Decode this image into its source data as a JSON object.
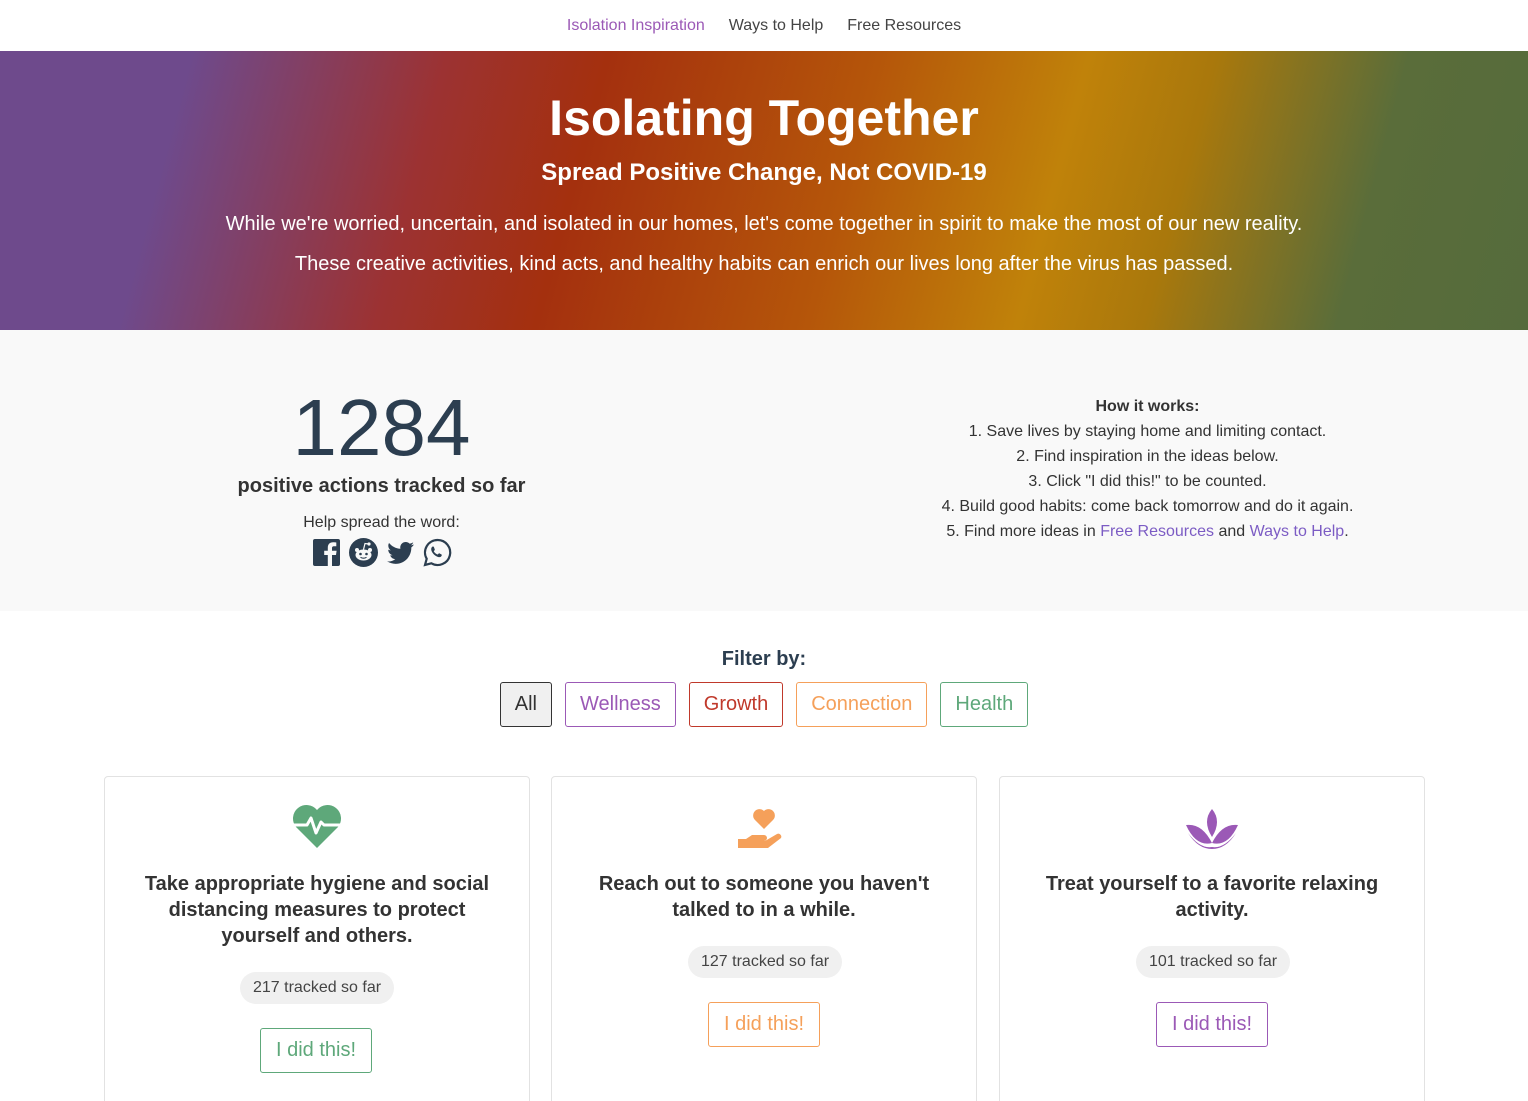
{
  "nav": {
    "items": [
      "Isolation Inspiration",
      "Ways to Help",
      "Free Resources"
    ]
  },
  "hero": {
    "title": "Isolating Together",
    "subtitle": "Spread Positive Change, Not COVID-19",
    "line1": "While we're worried, uncertain, and isolated in our homes, let's come together in spirit to make the most of our new reality.",
    "line2": "These creative activities, kind acts, and healthy habits can enrich our lives long after the virus has passed."
  },
  "stats": {
    "count": "1284",
    "count_label": "positive actions tracked so far",
    "spread_label": "Help spread the word:",
    "social": [
      "facebook-icon",
      "reddit-icon",
      "twitter-icon",
      "whatsapp-icon"
    ]
  },
  "how": {
    "heading": "How it works:",
    "step1": "1. Save lives by staying home and limiting contact.",
    "step2": "2. Find inspiration in the ideas below.",
    "step3": "3. Click \"I did this!\" to be counted.",
    "step4": "4. Build good habits: come back tomorrow and do it again.",
    "step5_prefix": "5. Find more ideas in",
    "step5_link1": "Free Resources",
    "step5_and": "and",
    "step5_link2": "Ways to Help",
    "step5_suffix": "."
  },
  "filter": {
    "label": "Filter by:",
    "buttons": [
      "All",
      "Wellness",
      "Growth",
      "Connection",
      "Health"
    ]
  },
  "cards": [
    {
      "icon": "heartbeat-icon",
      "title": "Take appropriate hygiene and social distancing measures to protect yourself and others.",
      "count": "217 tracked so far",
      "button": "I did this!",
      "color": "#5ea87a"
    },
    {
      "icon": "hand-heart-icon",
      "title": "Reach out to someone you haven't talked to in a while.",
      "count": "127 tracked so far",
      "button": "I did this!",
      "color": "#f5a05a"
    },
    {
      "icon": "lotus-icon",
      "title": "Treat yourself to a favorite relaxing activity.",
      "count": "101 tracked so far",
      "button": "I did this!",
      "color": "#9b59b6"
    }
  ]
}
